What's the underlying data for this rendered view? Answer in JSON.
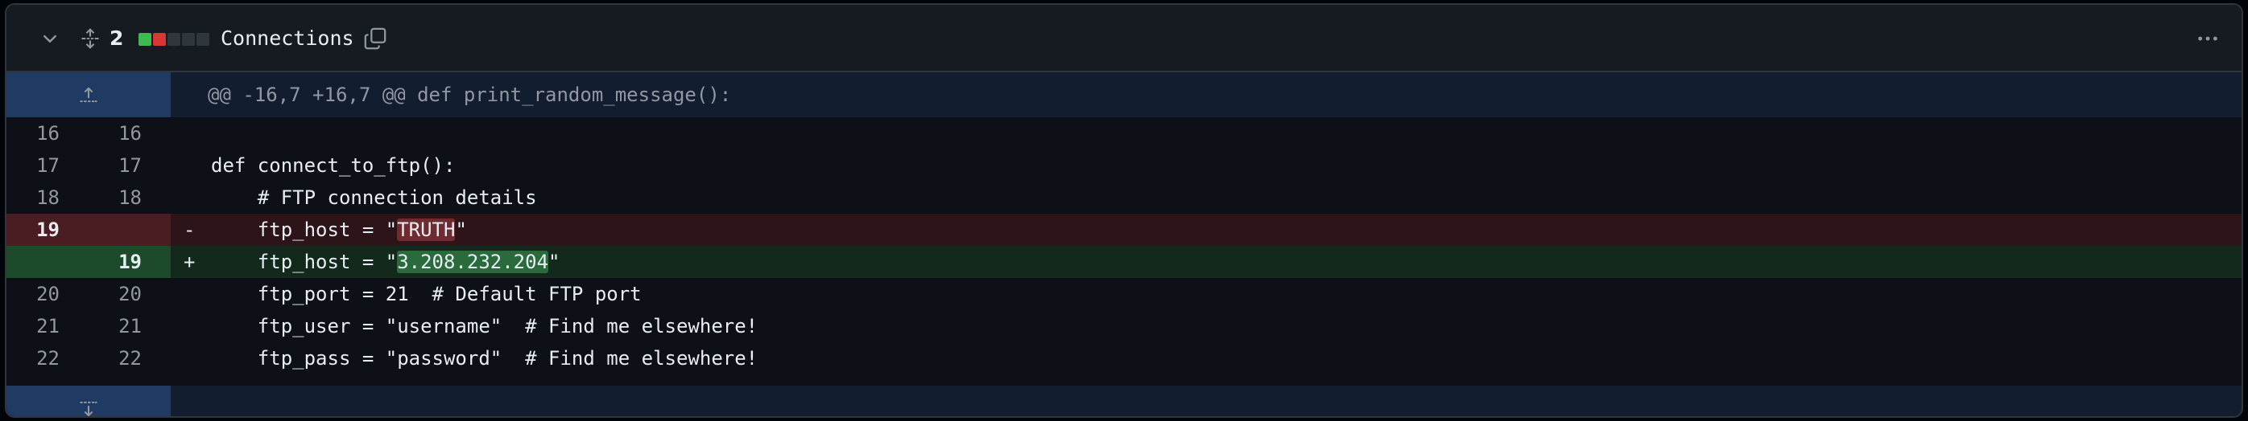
{
  "file_header": {
    "change_count": "2",
    "file_name": "Connections",
    "diffstat": [
      "#3fb950",
      "#da3633",
      "#30363d",
      "#30363d",
      "#30363d"
    ],
    "icons": {
      "collapse": "chevron-down-icon",
      "expand": "unfold-icon",
      "copy": "copy-icon",
      "more": "kebab-horizontal-icon"
    }
  },
  "hunk_header": "@@ -16,7 +16,7 @@ def print_random_message():",
  "lines": [
    {
      "type": "context",
      "old": "16",
      "new": "16",
      "marker": "",
      "code": ""
    },
    {
      "type": "context",
      "old": "17",
      "new": "17",
      "marker": "",
      "code": "def connect_to_ftp():"
    },
    {
      "type": "context",
      "old": "18",
      "new": "18",
      "marker": "",
      "code": "    # FTP connection details"
    },
    {
      "type": "del",
      "old": "19",
      "new": "",
      "marker": "-",
      "code_before": "    ftp_host = \"",
      "code_highlight": "TRUTH",
      "code_after": "\""
    },
    {
      "type": "add",
      "old": "",
      "new": "19",
      "marker": "+",
      "code_before": "    ftp_host = \"",
      "code_highlight": "3.208.232.204",
      "code_after": "\""
    },
    {
      "type": "context",
      "old": "20",
      "new": "20",
      "marker": "",
      "code": "    ftp_port = 21  # Default FTP port"
    },
    {
      "type": "context",
      "old": "21",
      "new": "21",
      "marker": "",
      "code": "    ftp_user = \"username\"  # Find me elsewhere!"
    },
    {
      "type": "context",
      "old": "22",
      "new": "22",
      "marker": "",
      "code": "    ftp_pass = \"password\"  # Find me elsewhere!"
    }
  ],
  "colors": {
    "addition": "#3fb950",
    "deletion": "#da3633",
    "hunk_gutter": "#1f3a63"
  }
}
